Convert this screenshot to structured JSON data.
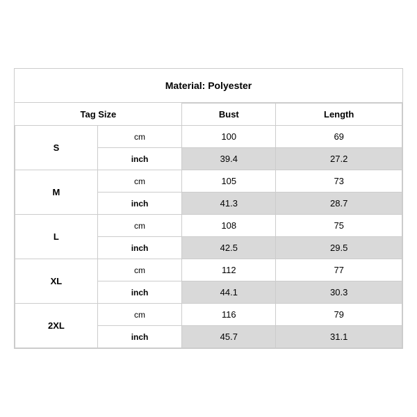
{
  "title": "Material: Polyester",
  "headers": {
    "tag_size": "Tag Size",
    "bust": "Bust",
    "length": "Length"
  },
  "rows": [
    {
      "size": "S",
      "cm": {
        "bust": "100",
        "length": "69"
      },
      "inch": {
        "bust": "39.4",
        "length": "27.2"
      }
    },
    {
      "size": "M",
      "cm": {
        "bust": "105",
        "length": "73"
      },
      "inch": {
        "bust": "41.3",
        "length": "28.7"
      }
    },
    {
      "size": "L",
      "cm": {
        "bust": "108",
        "length": "75"
      },
      "inch": {
        "bust": "42.5",
        "length": "29.5"
      }
    },
    {
      "size": "XL",
      "cm": {
        "bust": "112",
        "length": "77"
      },
      "inch": {
        "bust": "44.1",
        "length": "30.3"
      }
    },
    {
      "size": "2XL",
      "cm": {
        "bust": "116",
        "length": "79"
      },
      "inch": {
        "bust": "45.7",
        "length": "31.1"
      }
    }
  ],
  "units": {
    "cm": "cm",
    "inch": "inch"
  }
}
